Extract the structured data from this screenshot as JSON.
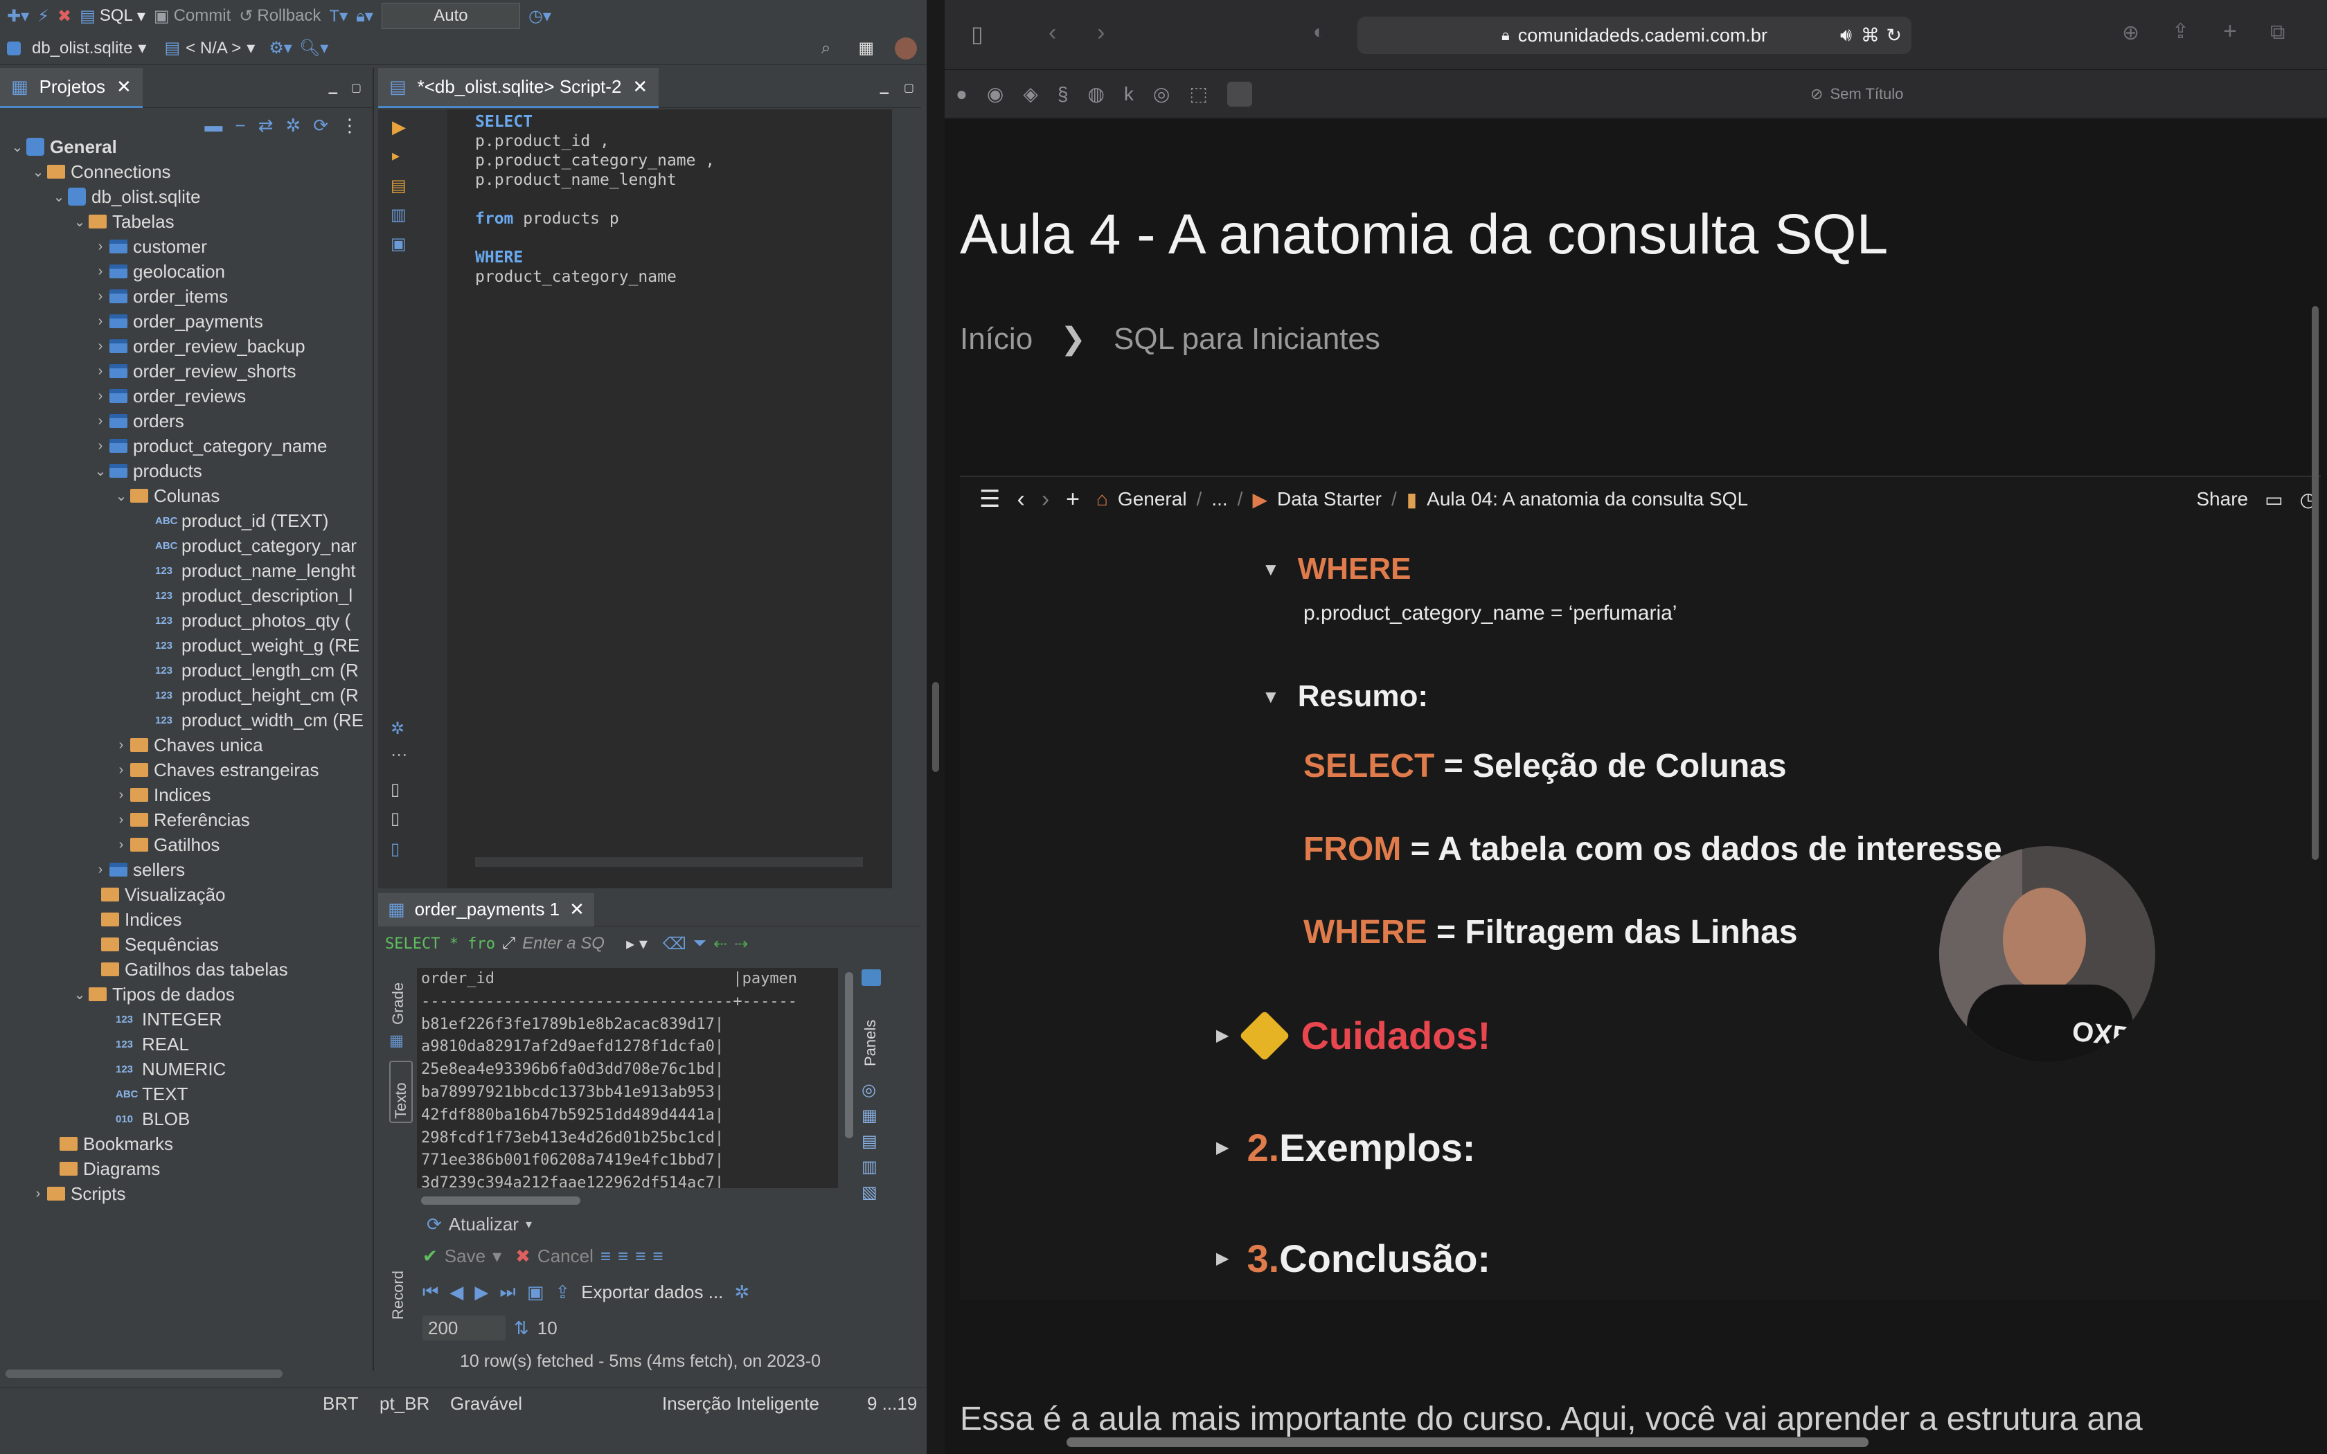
{
  "toolbar": {
    "sql": "SQL",
    "commit": "Commit",
    "rollback": "Rollback",
    "transaction_mode": "Auto",
    "connection": "db_olist.sqlite",
    "schema": "< N/A >"
  },
  "projects": {
    "tab": "Projetos",
    "tree": {
      "general": "General",
      "connections": "Connections",
      "db": "db_olist.sqlite",
      "tables_folder": "Tabelas",
      "tables": [
        "customer",
        "geolocation",
        "order_items",
        "order_payments",
        "order_review_backup",
        "order_review_shorts",
        "order_reviews",
        "orders",
        "product_category_name",
        "products"
      ],
      "columns_folder": "Colunas",
      "columns": [
        {
          "type": "ABC",
          "label": "product_id (TEXT)"
        },
        {
          "type": "ABC",
          "label": "product_category_nar"
        },
        {
          "type": "123",
          "label": "product_name_lenght"
        },
        {
          "type": "123",
          "label": "product_description_l"
        },
        {
          "type": "123",
          "label": "product_photos_qty ("
        },
        {
          "type": "123",
          "label": "product_weight_g (RE"
        },
        {
          "type": "123",
          "label": "product_length_cm (R"
        },
        {
          "type": "123",
          "label": "product_height_cm (R"
        },
        {
          "type": "123",
          "label": "product_width_cm (RE"
        }
      ],
      "product_subfolders": [
        "Chaves unica",
        "Chaves estrangeiras",
        "Indices",
        "Referências",
        "Gatilhos"
      ],
      "sellers": "sellers",
      "db_folders": [
        "Visualização",
        "Indices",
        "Sequências",
        "Gatilhos das tabelas"
      ],
      "types_folder": "Tipos de dados",
      "types": [
        {
          "type": "123",
          "label": "INTEGER"
        },
        {
          "type": "123",
          "label": "REAL"
        },
        {
          "type": "123",
          "label": "NUMERIC"
        },
        {
          "type": "ABC",
          "label": "TEXT"
        },
        {
          "type": "010",
          "label": "BLOB"
        }
      ],
      "bookmarks": "Bookmarks",
      "diagrams": "Diagrams",
      "scripts": "Scripts"
    }
  },
  "editor": {
    "tab": "*<db_olist.sqlite> Script-2",
    "lines": [
      "SELECT",
      "p.product_id ,",
      "p.product_category_name ,",
      "p.product_name_lenght",
      "",
      "from products p",
      "",
      "WHERE",
      "product_category_name"
    ]
  },
  "results": {
    "tab": "order_payments 1",
    "filter_sql": "SELECT * fro",
    "filter_placeholder": "Enter a SQ",
    "header": "order_id                          |paymen",
    "separator": "----------------------------------+------",
    "rows": [
      "b81ef226f3fe1789b1e8b2acac839d17|",
      "a9810da82917af2d9aefd1278f1dcfa0|",
      "25e8ea4e93396b6fa0d3dd708e76c1bd|",
      "ba78997921bbcdc1373bb41e913ab953|",
      "42fdf880ba16b47b59251dd489d4441a|",
      "298fcdf1f73eb413e4d26d01b25bc1cd|",
      "771ee386b001f06208a7419e4fc1bbd7|",
      "3d7239c394a212faae122962df514ac7|"
    ],
    "side_grade": "Grade",
    "side_texto": "Texto",
    "side_record": "Record",
    "panels": "Panels",
    "refresh": "Atualizar",
    "save": "Save",
    "cancel": "Cancel",
    "export": "Exportar dados ...",
    "fetch_size": "200",
    "row_count": "10",
    "status": "10 row(s) fetched - 5ms (4ms fetch), on 2023-0"
  },
  "statusbar": {
    "tz": "BRT",
    "locale": "pt_BR",
    "mode": "Gravável",
    "insert": "Inserção Inteligente",
    "pos": "9 ...19"
  },
  "browser": {
    "url": "comunidadeds.cademi.com.br",
    "untitled": "Sem Título"
  },
  "lesson": {
    "title": "Aula 4 - A anatomia da consulta SQL",
    "crumb_home": "Início",
    "crumb_course": "SQL para Iniciantes",
    "notion": {
      "path": [
        "General",
        "...",
        "Data Starter",
        "Aula 04: A anatomia da consulta SQL"
      ],
      "share": "Share",
      "where_heading": "WHERE",
      "where_code": "p.product_category_name = ‘perfumaria’",
      "summary_heading": "Resumo:",
      "summary": [
        {
          "kw": "SELECT",
          "text": " = Seleção de Colunas"
        },
        {
          "kw": "FROM",
          "text": " = A tabela com os dados de interesse"
        },
        {
          "kw": "WHERE",
          "text": " = Filtragem das Linhas"
        }
      ],
      "cautions": "Cuidados!",
      "sections": [
        {
          "num": "2.",
          "label": "Exemplos:"
        },
        {
          "num": "3.",
          "label": "Conclusão:"
        }
      ]
    },
    "footer": "Essa é a aula mais importante do curso. Aqui, você vai aprender a estrutura ana",
    "shirt": "OXE"
  },
  "colors": {
    "accent_orange": "#e07c4c",
    "caution_red": "#e8474f",
    "ide_blue": "#4a88c7"
  }
}
